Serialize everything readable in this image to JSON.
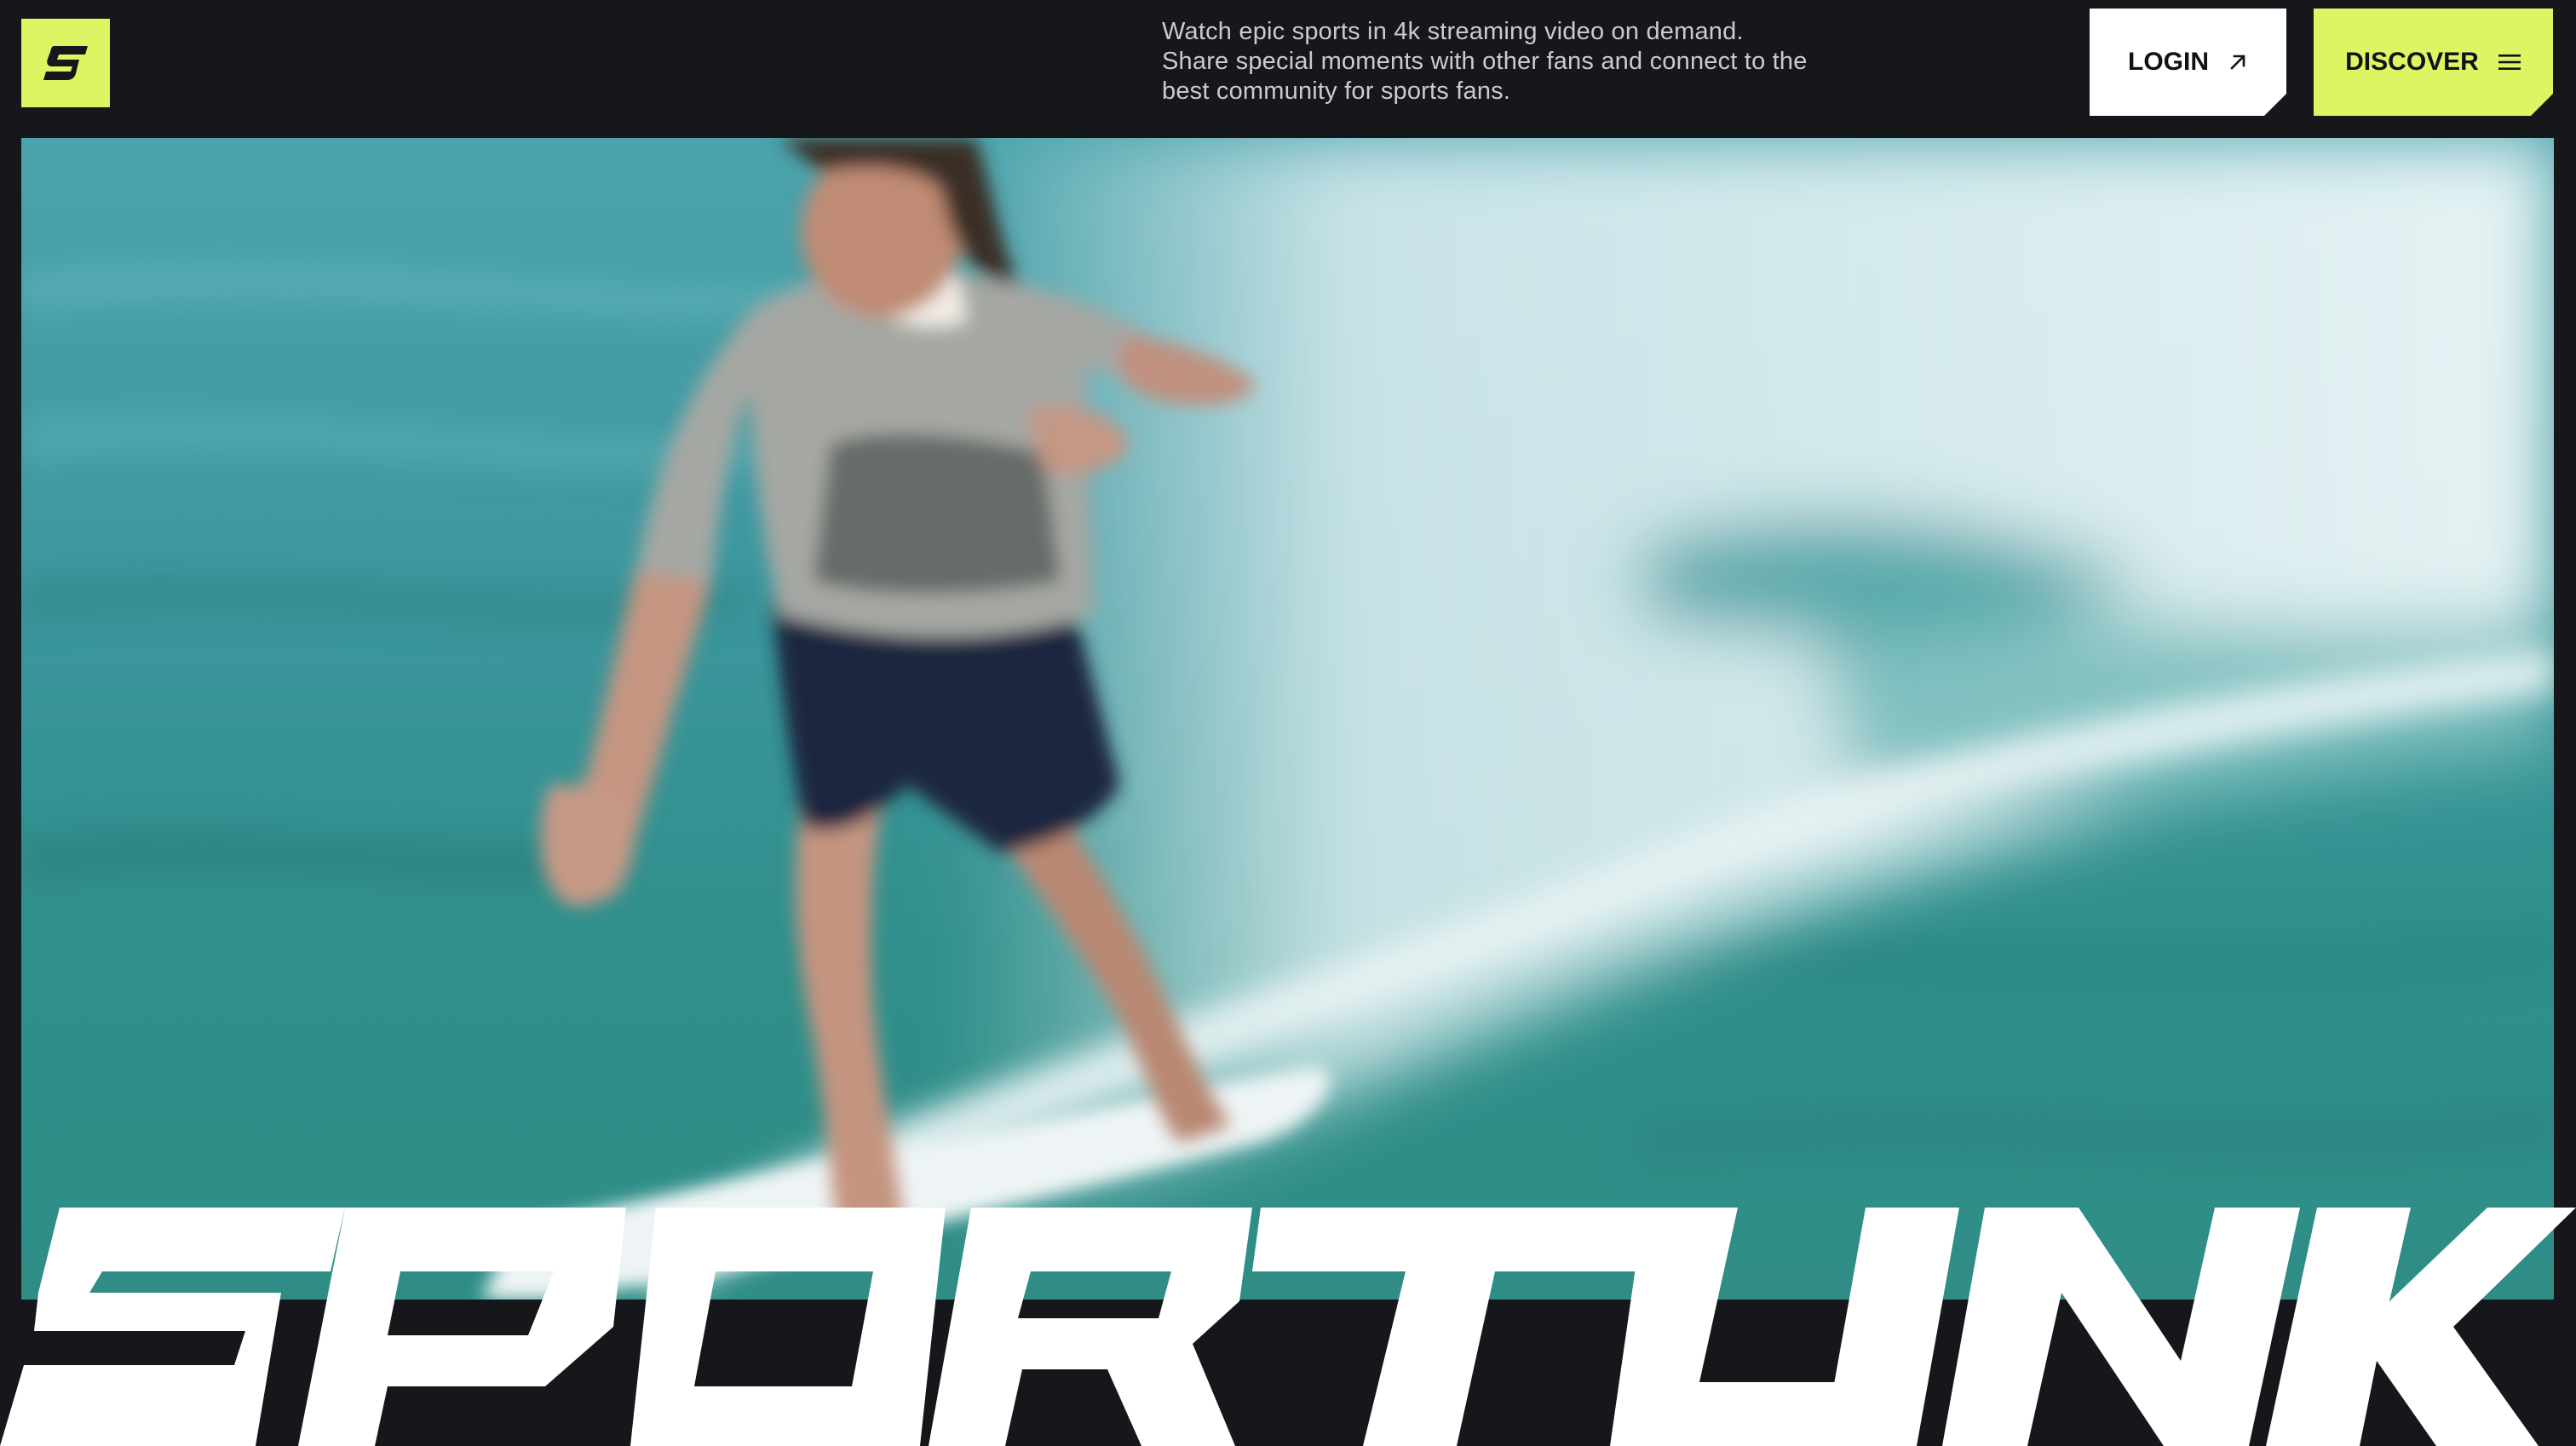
{
  "brand": {
    "name": "SPORTLINK",
    "logo_icon": "sportlink-s-logo-icon",
    "accent_color": "#dcf562",
    "background_color": "#16171b"
  },
  "header": {
    "tagline": "Watch epic sports in 4k streaming video on demand. Share special moments with other fans and connect to the best community for sports fans.",
    "login_label": "LOGIN",
    "login_icon": "arrow-up-right-icon",
    "discover_label": "DISCOVER",
    "discover_icon": "hamburger-menu-icon"
  },
  "hero": {
    "image": "surfer-riding-wave-photo"
  }
}
